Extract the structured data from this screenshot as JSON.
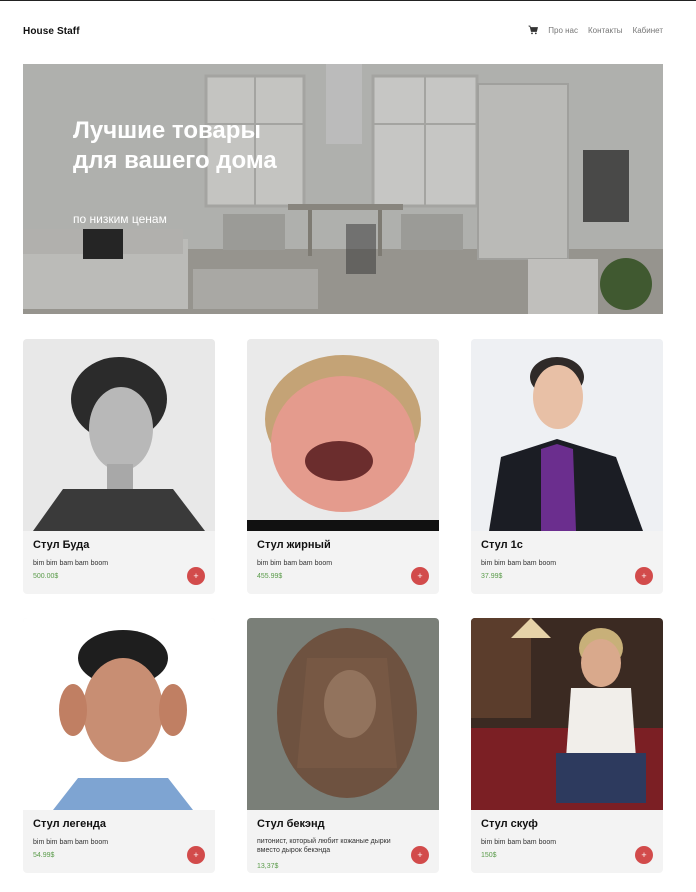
{
  "header": {
    "brand": "House Staff",
    "nav": [
      "Про нас",
      "Контакты",
      "Кабинет"
    ]
  },
  "hero": {
    "title": "Лучшие товары для вашего дома",
    "subtitle": "по низким ценам"
  },
  "products": [
    {
      "title": "Стул Буда",
      "desc": "bim bim bam bam boom",
      "price": "500.00$"
    },
    {
      "title": "Стул жирный",
      "desc": "bim bim bam bam boom",
      "price": "455.99$"
    },
    {
      "title": "Стул 1с",
      "desc": "bim bim bam bam boom",
      "price": "37.99$"
    },
    {
      "title": "Стул легенда",
      "desc": "bim bim bam bam boom",
      "price": "54.99$"
    },
    {
      "title": "Стул бекэнд",
      "desc": "питонист, который любит кожаные дырки вместо дырок бекэнда",
      "price": "13,37$"
    },
    {
      "title": "Стул скуф",
      "desc": "bim bim bam bam boom",
      "price": "150$"
    }
  ],
  "icons": {
    "cart": "cart-icon",
    "add": "plus-icon"
  },
  "colors": {
    "accent": "#d24b4b",
    "price": "#5a9b4a"
  }
}
